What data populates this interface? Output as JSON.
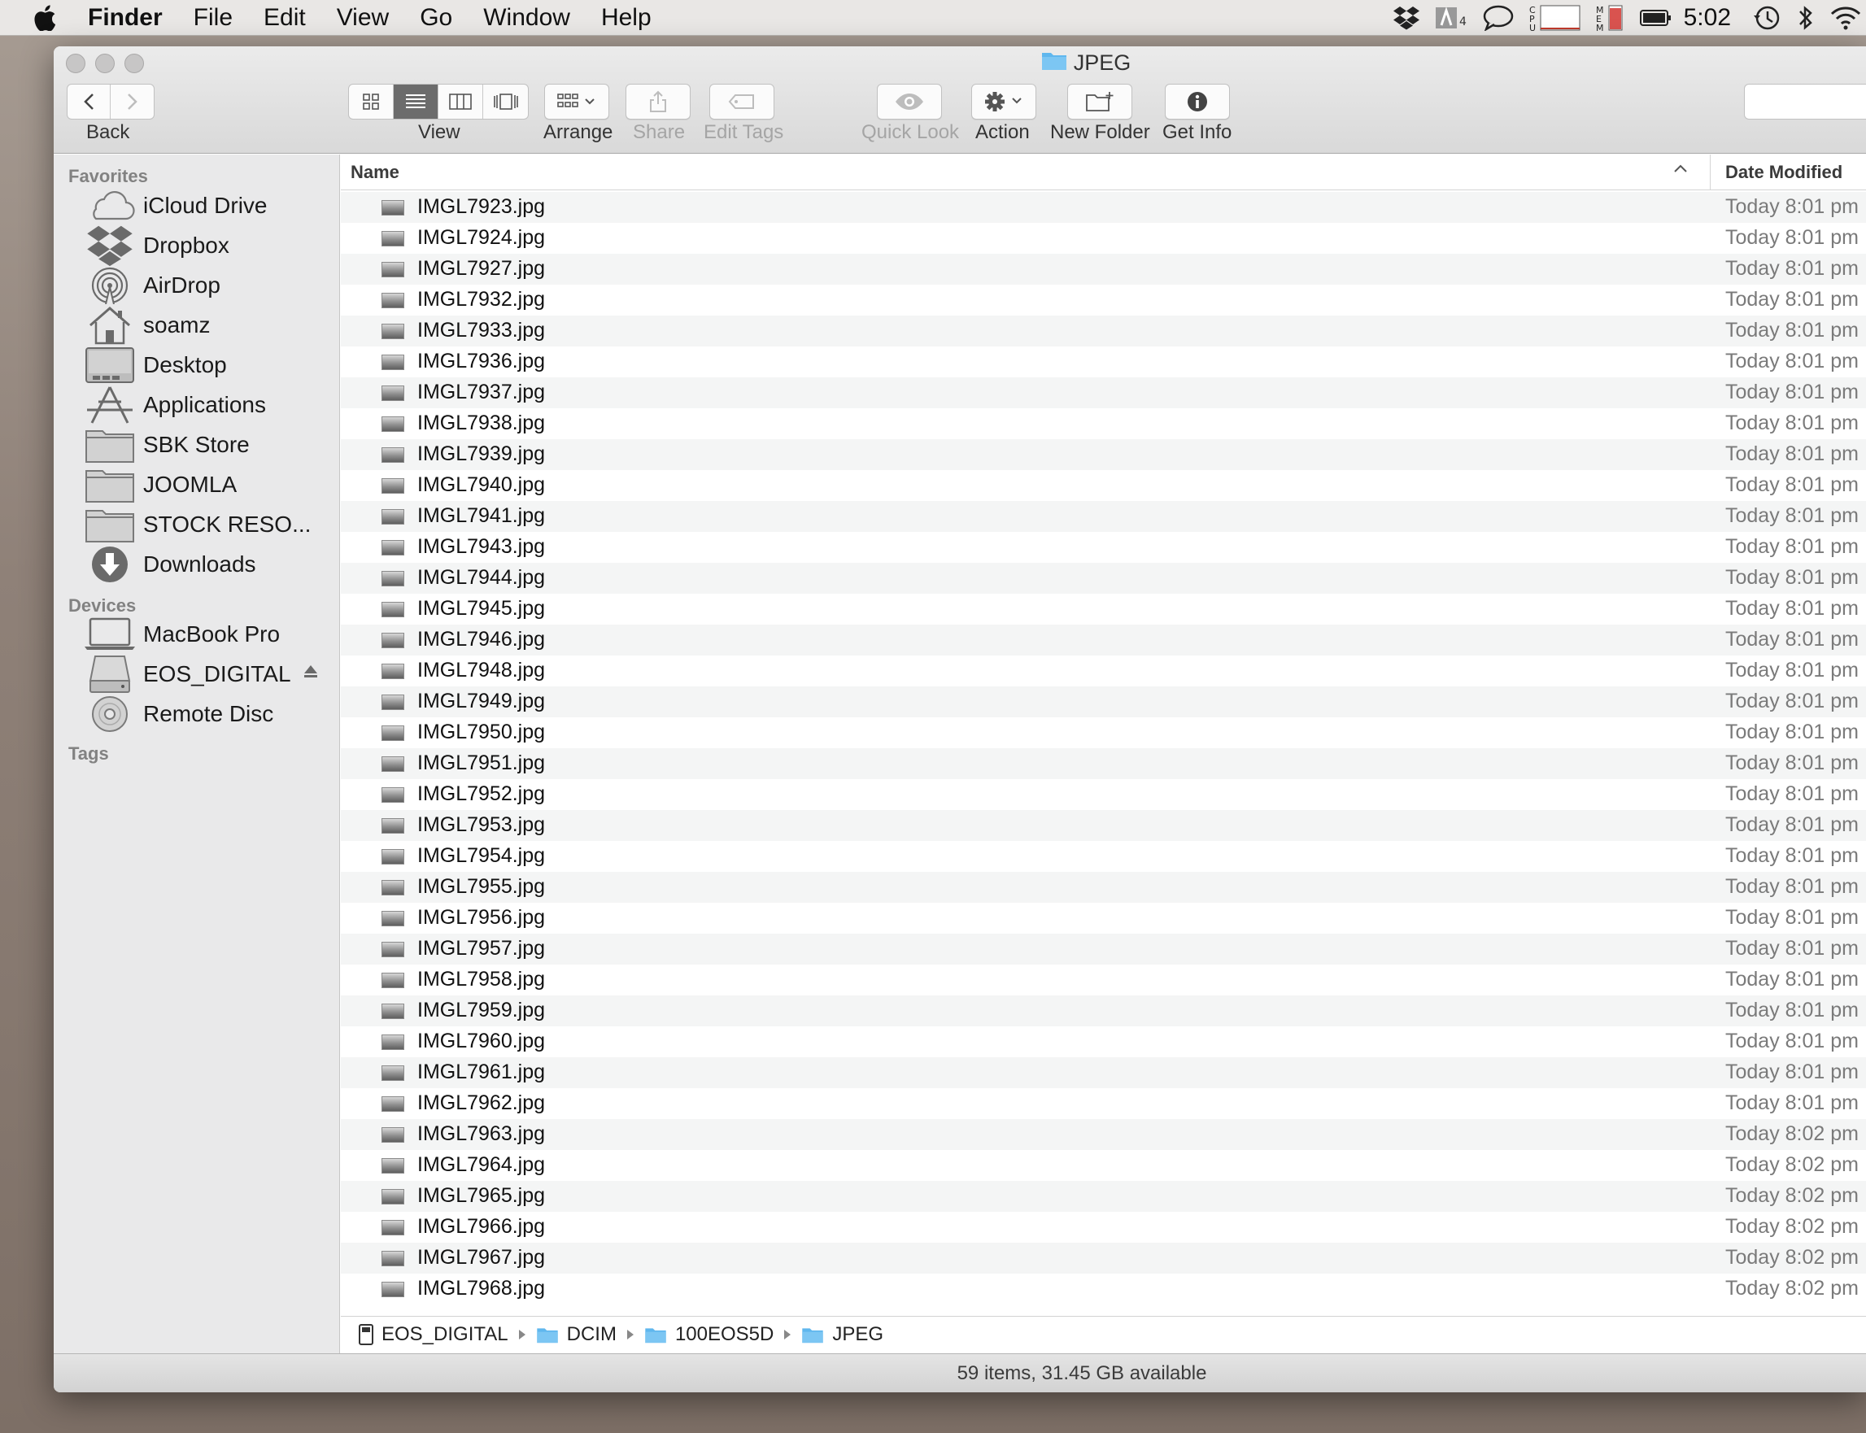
{
  "menubar": {
    "app_name": "Finder",
    "menus": [
      "File",
      "Edit",
      "View",
      "Go",
      "Window",
      "Help"
    ],
    "clock": "5:02"
  },
  "window": {
    "title": "JPEG"
  },
  "toolbar": {
    "back_label": "Back",
    "view_label": "View",
    "arrange_label": "Arrange",
    "share_label": "Share",
    "edit_tags_label": "Edit Tags",
    "quick_look_label": "Quick Look",
    "action_label": "Action",
    "new_folder_label": "New Folder",
    "get_info_label": "Get Info"
  },
  "sidebar": {
    "favorites_heading": "Favorites",
    "favorites": [
      {
        "label": "iCloud Drive",
        "icon": "cloud-icon"
      },
      {
        "label": "Dropbox",
        "icon": "dropbox-icon"
      },
      {
        "label": "AirDrop",
        "icon": "airdrop-icon"
      },
      {
        "label": "soamz",
        "icon": "home-icon"
      },
      {
        "label": "Desktop",
        "icon": "desktop-icon"
      },
      {
        "label": "Applications",
        "icon": "applications-icon"
      },
      {
        "label": "SBK Store",
        "icon": "folder-icon"
      },
      {
        "label": "JOOMLA",
        "icon": "folder-icon"
      },
      {
        "label": "STOCK RESO...",
        "icon": "folder-icon"
      },
      {
        "label": "Downloads",
        "icon": "downloads-icon"
      }
    ],
    "devices_heading": "Devices",
    "devices": [
      {
        "label": "MacBook Pro",
        "icon": "laptop-icon"
      },
      {
        "label": "EOS_DIGITAL",
        "icon": "drive-icon"
      },
      {
        "label": "Remote Disc",
        "icon": "disc-icon"
      }
    ],
    "tags_heading": "Tags"
  },
  "list": {
    "col_name": "Name",
    "col_date": "Date Modified",
    "rows": [
      {
        "name": "IMGL7923.jpg",
        "date": "Today 8:01 pm"
      },
      {
        "name": "IMGL7924.jpg",
        "date": "Today 8:01 pm"
      },
      {
        "name": "IMGL7927.jpg",
        "date": "Today 8:01 pm"
      },
      {
        "name": "IMGL7932.jpg",
        "date": "Today 8:01 pm"
      },
      {
        "name": "IMGL7933.jpg",
        "date": "Today 8:01 pm"
      },
      {
        "name": "IMGL7936.jpg",
        "date": "Today 8:01 pm"
      },
      {
        "name": "IMGL7937.jpg",
        "date": "Today 8:01 pm"
      },
      {
        "name": "IMGL7938.jpg",
        "date": "Today 8:01 pm"
      },
      {
        "name": "IMGL7939.jpg",
        "date": "Today 8:01 pm"
      },
      {
        "name": "IMGL7940.jpg",
        "date": "Today 8:01 pm"
      },
      {
        "name": "IMGL7941.jpg",
        "date": "Today 8:01 pm"
      },
      {
        "name": "IMGL7943.jpg",
        "date": "Today 8:01 pm"
      },
      {
        "name": "IMGL7944.jpg",
        "date": "Today 8:01 pm"
      },
      {
        "name": "IMGL7945.jpg",
        "date": "Today 8:01 pm"
      },
      {
        "name": "IMGL7946.jpg",
        "date": "Today 8:01 pm"
      },
      {
        "name": "IMGL7948.jpg",
        "date": "Today 8:01 pm"
      },
      {
        "name": "IMGL7949.jpg",
        "date": "Today 8:01 pm"
      },
      {
        "name": "IMGL7950.jpg",
        "date": "Today 8:01 pm"
      },
      {
        "name": "IMGL7951.jpg",
        "date": "Today 8:01 pm"
      },
      {
        "name": "IMGL7952.jpg",
        "date": "Today 8:01 pm"
      },
      {
        "name": "IMGL7953.jpg",
        "date": "Today 8:01 pm"
      },
      {
        "name": "IMGL7954.jpg",
        "date": "Today 8:01 pm"
      },
      {
        "name": "IMGL7955.jpg",
        "date": "Today 8:01 pm"
      },
      {
        "name": "IMGL7956.jpg",
        "date": "Today 8:01 pm"
      },
      {
        "name": "IMGL7957.jpg",
        "date": "Today 8:01 pm"
      },
      {
        "name": "IMGL7958.jpg",
        "date": "Today 8:01 pm"
      },
      {
        "name": "IMGL7959.jpg",
        "date": "Today 8:01 pm"
      },
      {
        "name": "IMGL7960.jpg",
        "date": "Today 8:01 pm"
      },
      {
        "name": "IMGL7961.jpg",
        "date": "Today 8:01 pm"
      },
      {
        "name": "IMGL7962.jpg",
        "date": "Today 8:01 pm"
      },
      {
        "name": "IMGL7963.jpg",
        "date": "Today 8:02 pm"
      },
      {
        "name": "IMGL7964.jpg",
        "date": "Today 8:02 pm"
      },
      {
        "name": "IMGL7965.jpg",
        "date": "Today 8:02 pm"
      },
      {
        "name": "IMGL7966.jpg",
        "date": "Today 8:02 pm"
      },
      {
        "name": "IMGL7967.jpg",
        "date": "Today 8:02 pm"
      },
      {
        "name": "IMGL7968.jpg",
        "date": "Today 8:02 pm"
      }
    ]
  },
  "pathbar": [
    {
      "label": "EOS_DIGITAL",
      "icon": "drive-icon"
    },
    {
      "label": "DCIM",
      "icon": "folder-icon"
    },
    {
      "label": "100EOS5D",
      "icon": "folder-icon"
    },
    {
      "label": "JPEG",
      "icon": "folder-icon"
    }
  ],
  "status": {
    "text": "59 items, 31.45 GB available"
  },
  "colors": {
    "folder_blue": "#5fb7ee",
    "sidebar_bg": "#e9e9ea",
    "alt_row": "#f4f5f5"
  }
}
